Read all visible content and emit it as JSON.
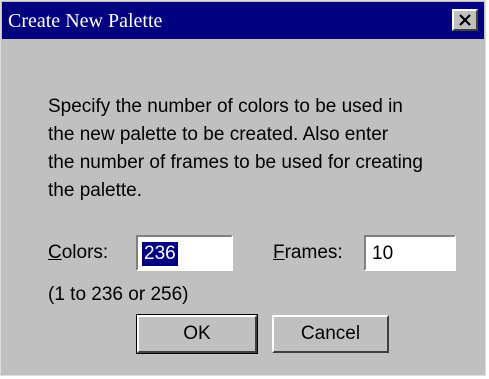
{
  "window": {
    "title": "Create New Palette",
    "close_glyph": "×",
    "close_icon": "close-icon"
  },
  "description": {
    "lines": [
      "Specify the number of colors to be used in",
      "the new palette to be created. Also enter",
      "the number of frames to be used for creating",
      "the palette."
    ]
  },
  "colors": {
    "label_mnemonic": "C",
    "label_rest": "olors:",
    "value": "236",
    "range_hint": "(1 to 236 or 256)"
  },
  "frames": {
    "label_mnemonic": "F",
    "label_rest": "rames:",
    "value": "10"
  },
  "buttons": {
    "ok": "OK",
    "cancel": "Cancel"
  },
  "colors_theme": {
    "titlebar": "#000080",
    "face": "#c0c0c0",
    "selection": "#000080"
  }
}
